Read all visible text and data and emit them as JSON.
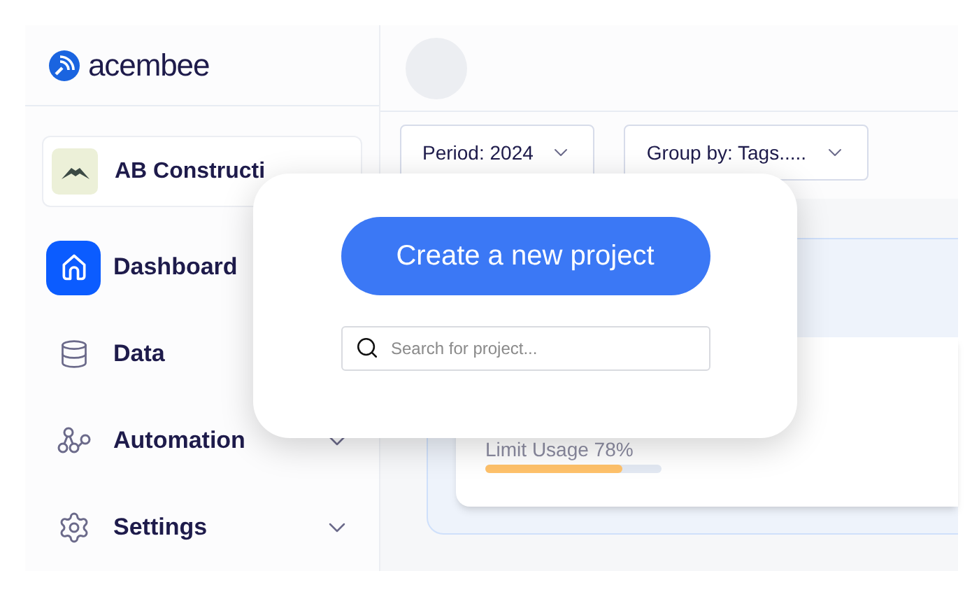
{
  "brand": {
    "name": "acembee"
  },
  "company": {
    "name": "AB Constructi"
  },
  "nav": [
    {
      "label": "Dashboard",
      "kind": "link",
      "selected": true
    },
    {
      "label": "Data",
      "kind": "link",
      "selected": false
    },
    {
      "label": "Automation",
      "kind": "group",
      "selected": false,
      "expanded": false
    },
    {
      "label": "Settings",
      "kind": "group",
      "selected": false,
      "expanded": false
    }
  ],
  "filters": [
    {
      "label": "Period: 2024"
    },
    {
      "label": "Group by: Tags....."
    }
  ],
  "usage": {
    "label": "Limit Usage 78%",
    "level": 0.78
  },
  "modal": {
    "button": "Create a new project",
    "search": {
      "placeholder": "Search for project..."
    }
  }
}
